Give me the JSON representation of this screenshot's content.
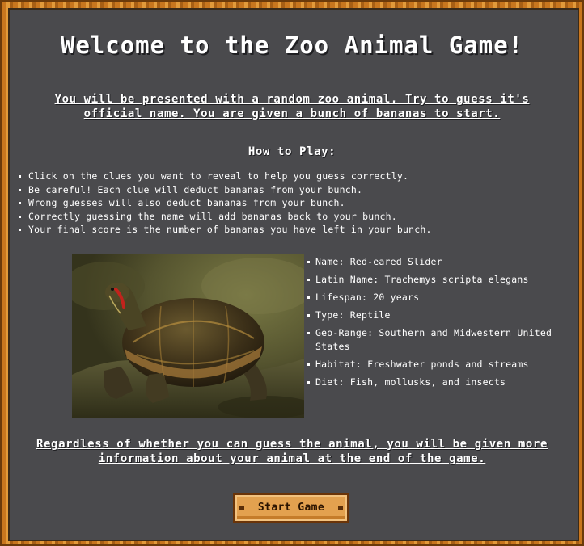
{
  "game": {
    "title": "Welcome to the Zoo Animal Game!",
    "intro": "You will be presented with a random zoo animal. Try to guess it's official name. You are given a bunch of bananas to start.",
    "how_to_heading": "How to Play:",
    "rules": [
      "Click on the clues you want to reveal to help you guess correctly.",
      "Be careful! Each clue will deduct bananas from your bunch.",
      "Wrong guesses will also deduct bananas from your bunch.",
      "Correctly guessing the name will add bananas back to your bunch.",
      "Your final score is the number of bananas you have left in your bunch."
    ],
    "clues": [
      "Name: Red-eared Slider",
      "Latin Name: Trachemys scripta elegans",
      "Lifespan: 20 years",
      "Type: Reptile",
      "Geo-Range: Southern and Midwestern United States",
      "Habitat: Freshwater ponds and streams",
      "Diet: Fish, mollusks, and insects"
    ],
    "outro": "Regardless of whether you can guess the animal, you will be given more information about your animal at the end of the game.",
    "start_button_label": "Start Game"
  },
  "colors": {
    "background": "#4a4a4d",
    "frame": "#c8761e",
    "text": "#ffffff",
    "button": "#e3a14f"
  }
}
